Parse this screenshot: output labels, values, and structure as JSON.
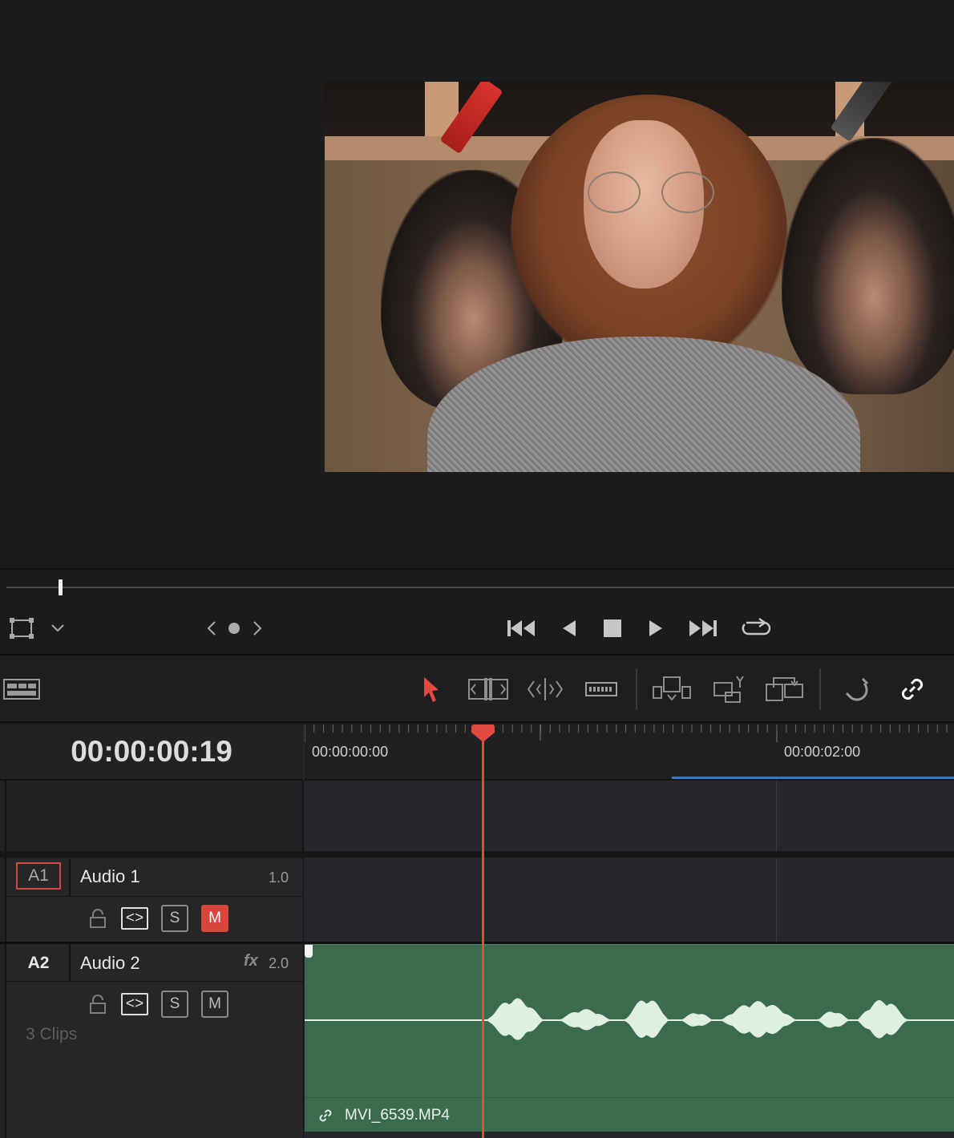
{
  "viewer": {
    "frame_alt": "Video frame: presenter with curly hair and glasses in grey sweater in front of two portrait paintings"
  },
  "transport": {
    "buttons": [
      "jump-to-start",
      "play-reverse",
      "stop",
      "play",
      "jump-to-end",
      "loop"
    ]
  },
  "toolbar": {
    "tools": [
      "selection-mode",
      "trim-edit-mode",
      "dynamic-trim-mode",
      "blade-edit-mode",
      "insert-clip",
      "overwrite-clip",
      "replace-clip",
      "snapping",
      "linked-selection"
    ]
  },
  "timeline": {
    "timecode": "00:00:00:19",
    "ruler_labels": [
      "00:00:00:00",
      "00:00:02:00"
    ],
    "tracks": [
      {
        "id": "A1",
        "name": "Audio 1",
        "number": "1.0",
        "fx": "",
        "lock": "",
        "auto": "<>",
        "solo": "S",
        "mute": "M",
        "mute_active": true,
        "clips": ""
      },
      {
        "id": "A2",
        "name": "Audio 2",
        "number": "2.0",
        "fx": "fx",
        "lock": "",
        "auto": "<>",
        "solo": "S",
        "mute": "M",
        "mute_active": false,
        "clips": "3 Clips"
      }
    ],
    "clip": {
      "name": "MVI_6539.MP4"
    }
  },
  "colors": {
    "playhead": "#e34a3f",
    "clip_audio": "#3a6b4d",
    "waveform": "#dff0e3",
    "accent_blue": "#2c79cd",
    "active_tool": "#e34a3f"
  }
}
